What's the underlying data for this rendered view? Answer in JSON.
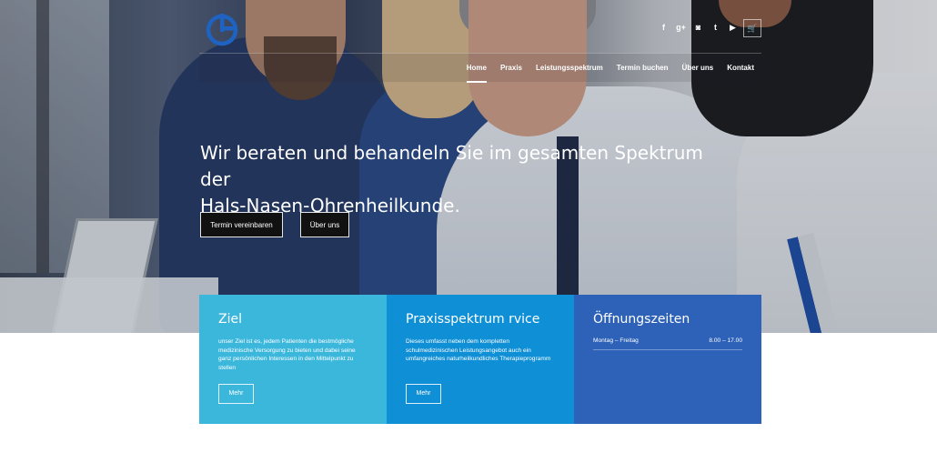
{
  "nav": {
    "items": [
      "Home",
      "Praxis",
      "Leistungsspektrum",
      "Termin buchen",
      "Über uns",
      "Kontakt"
    ],
    "active": "Home"
  },
  "social": [
    "f",
    "g+",
    "◙",
    "t",
    "▶",
    "🛒"
  ],
  "hero": {
    "headline_line1": "Wir beraten und behandeln Sie im gesamten Spektrum der",
    "headline_line2": "Hals-Nasen-Ohrenheilkunde.",
    "button_primary": "Termin vereinbaren",
    "button_secondary": "Über uns"
  },
  "boxes": [
    {
      "title": "Ziel",
      "text": "unser Ziel ist es, jedem Patienten die bestmögliche medizinische Versorgung zu bieten und dabei seine ganz persönlichen Interessen in den Mittelpunkt zu stellen",
      "button": "Mehr",
      "color": "#3cb7dc"
    },
    {
      "title": "Praxisspektrum rvice",
      "text": "Dieses umfasst neben dem kompletten schulmedizinischen Leistungsangebot auch ein umfangreiches naturheilkundliches Therapieprogramm",
      "button": "Mehr",
      "color": "#0f8fd5"
    },
    {
      "title": "Öffnungszeiten",
      "hours_label": "Montag – Freitag",
      "hours_value": "8.00 – 17.00",
      "color": "#2d62b8"
    }
  ]
}
